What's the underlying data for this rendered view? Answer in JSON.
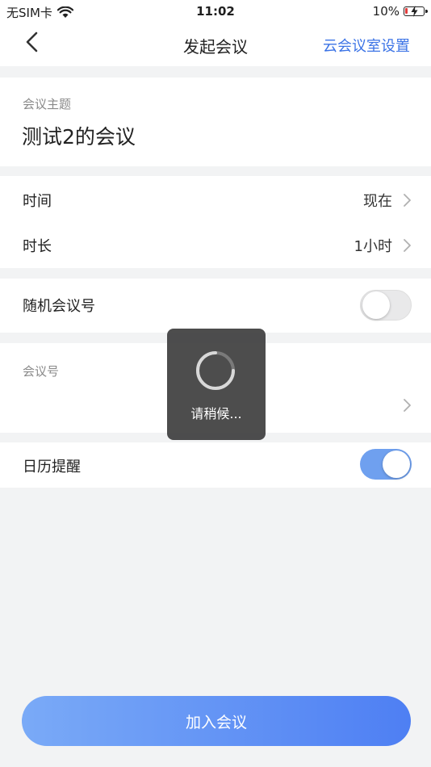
{
  "status_bar": {
    "carrier": "无SIM卡",
    "time": "11:02",
    "battery": "10%"
  },
  "nav": {
    "title": "发起会议",
    "action": "云会议室设置"
  },
  "subject": {
    "label": "会议主题",
    "value": "测试2的会议"
  },
  "time_row": {
    "label": "时间",
    "value": "现在"
  },
  "duration_row": {
    "label": "时长",
    "value": "1小时"
  },
  "random_id_row": {
    "label": "随机会议号",
    "toggle_on": false
  },
  "meeting_id": {
    "label": "会议号",
    "value": ""
  },
  "calendar_row": {
    "label": "日历提醒",
    "toggle_on": true
  },
  "loading": {
    "text": "请稍候..."
  },
  "join_button": {
    "label": "加入会议"
  },
  "colors": {
    "accent": "#3b73e6",
    "toggle_on": "#6fa0ef",
    "button_start": "#7aaaf7",
    "button_end": "#4e7ff3"
  }
}
